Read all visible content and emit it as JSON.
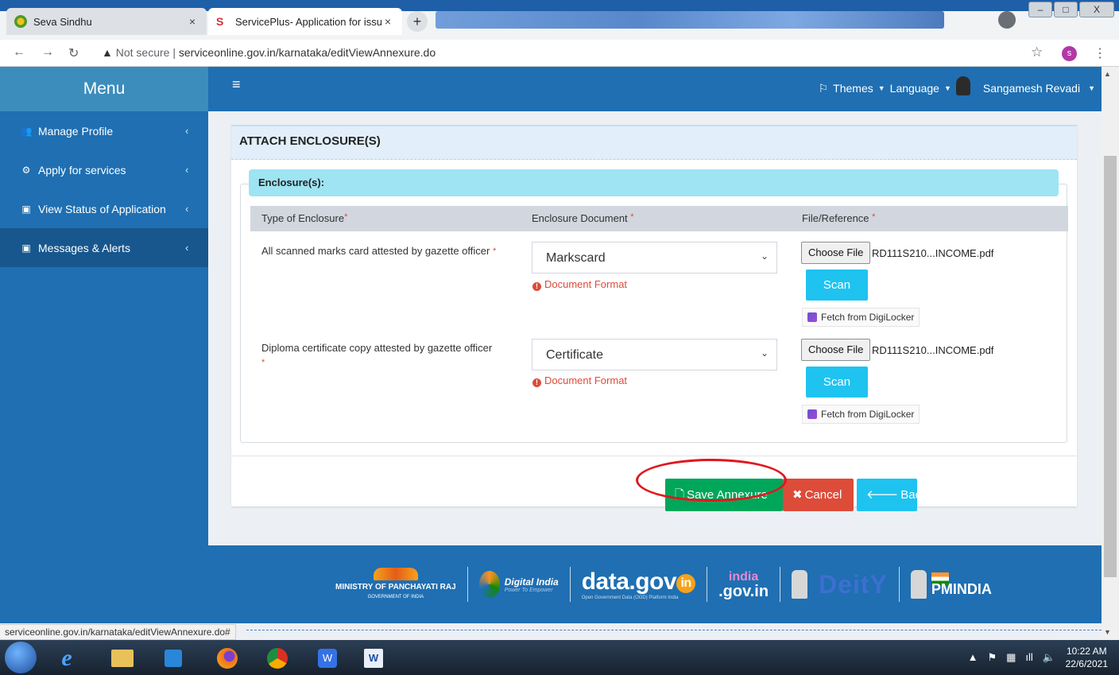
{
  "browser": {
    "tabs": [
      {
        "title": "Seva Sindhu",
        "close": "×"
      },
      {
        "title": "ServicePlus- Application for issue",
        "close": "×"
      }
    ],
    "new_tab": "+",
    "address": {
      "warning": "Not secure",
      "separator": "|",
      "url": "serviceonline.gov.in/karnataka/editViewAnnexure.do"
    },
    "profile_initial": "s",
    "window_buttons": [
      "–",
      "□",
      "X"
    ]
  },
  "sidebar": {
    "title": "Menu",
    "items": [
      {
        "label": "Manage Profile",
        "icon": "users-icon"
      },
      {
        "label": "Apply for services",
        "icon": "cogs-icon"
      },
      {
        "label": "View Status of Application",
        "icon": "window-icon"
      },
      {
        "label": "Messages & Alerts",
        "icon": "window-icon"
      }
    ]
  },
  "header": {
    "menu_icon": "≡",
    "themes": "Themes",
    "language": "Language",
    "user": "Sangamesh Revadi"
  },
  "form": {
    "title": "ATTACH ENCLOSURE(S)",
    "section": "Enclosure(s):",
    "columns": [
      "Type of Enclosure",
      "Enclosure Document",
      "File/Reference"
    ],
    "rows": [
      {
        "type": "All scanned marks card attested by gazette officer",
        "document": "Markscard",
        "format": "Document Format",
        "choose": "Choose File",
        "file": "RD111S210...INCOME.pdf",
        "scan": "Scan",
        "fetch": "Fetch from DigiLocker"
      },
      {
        "type": "Diploma certificate copy attested by gazette officer",
        "document": "Certificate",
        "format": "Document Format",
        "choose": "Choose File",
        "file": "RD111S210...INCOME.pdf",
        "scan": "Scan",
        "fetch": "Fetch from DigiLocker"
      }
    ],
    "buttons": {
      "save": "Save Annexure",
      "cancel": "Cancel",
      "back": "Back"
    }
  },
  "footer": {
    "ministry": "MINISTRY OF PANCHAYATI RAJ",
    "ministry_sub": "GOVERNMENT OF INDIA",
    "digital_india": "Digital India",
    "digital_india_sub": "Power To Empower",
    "datagov": "data.gov",
    "datagov_in": "in",
    "datagov_sub": "Open Government Data (OGD) Platform India",
    "indiagov_top": "india",
    "indiagov_bottom": ".gov.in",
    "deity": "DeitY",
    "pmindia": "PMINDIA"
  },
  "status_url": "serviceonline.gov.in/karnataka/editViewAnnexure.do#",
  "taskbar": {
    "time": "10:22 AM",
    "date": "22/6/2021"
  },
  "colors": {
    "sidebar": "#1f6fb2",
    "save": "#00a65a",
    "cancel": "#dd4b39",
    "back": "#1ec3f0",
    "highlight_ring": "#e0181e"
  }
}
